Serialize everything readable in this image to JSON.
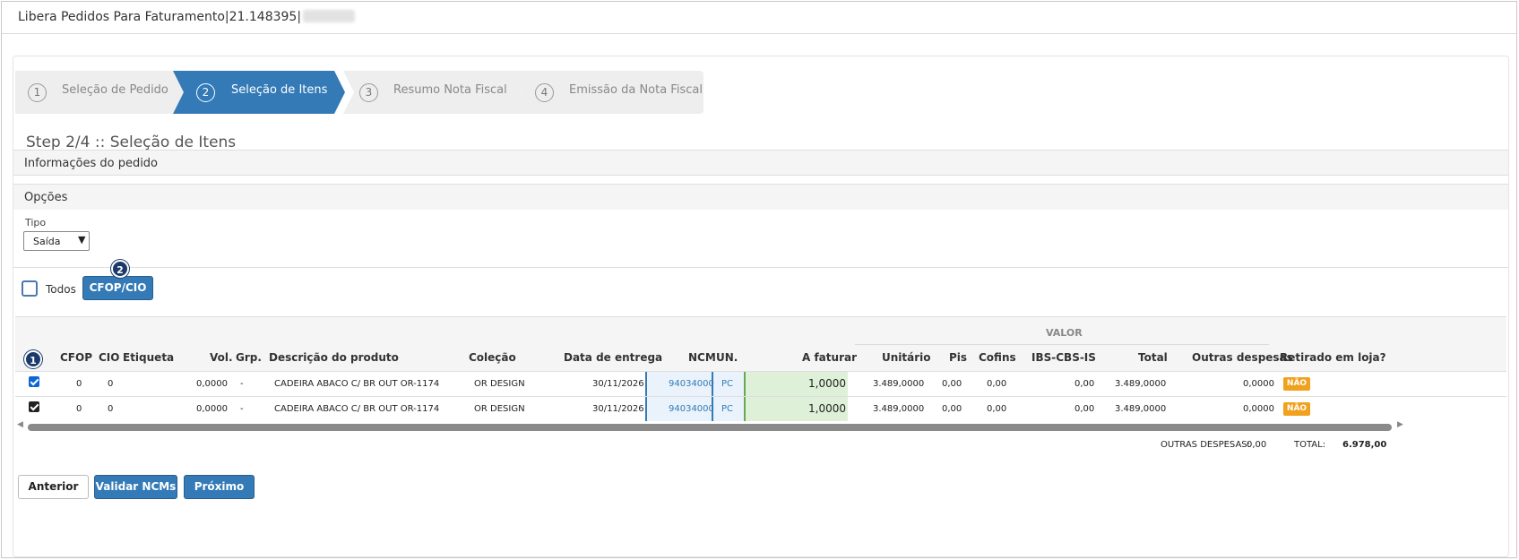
{
  "window": {
    "title": "Libera Pedidos Para Faturamento|21.148395|"
  },
  "wizard": [
    {
      "num": "1",
      "label": "Seleção de Pedido",
      "active": false
    },
    {
      "num": "2",
      "label": "Seleção de Itens",
      "active": true
    },
    {
      "num": "3",
      "label": "Resumo Nota Fiscal",
      "active": false
    },
    {
      "num": "4",
      "label": "Emissão da Nota Fiscal",
      "active": false
    }
  ],
  "step_title": "Step 2/4 :: Seleção de Itens",
  "sections": {
    "info": "Informações do pedido",
    "opcoes": "Opções"
  },
  "tipo": {
    "label": "Tipo",
    "value": "Saída"
  },
  "todos_label": "Todos",
  "cfop_button": "CFOP/CIO",
  "callouts": {
    "one": "1",
    "two": "2"
  },
  "table": {
    "group_header": "VALOR",
    "headers": {
      "cfop": "CFOP",
      "cio": "CIO",
      "etiqueta": "Etiqueta",
      "vol": "Vol.",
      "grp": "Grp.",
      "descricao": "Descrição do produto",
      "colecao": "Coleção",
      "data": "Data de entrega",
      "ncm": "NCM",
      "un": "UN.",
      "afaturar": "A faturar",
      "unitario": "Unitário",
      "pis": "Pis",
      "cofins": "Cofins",
      "ibs": "IBS-CBS-IS",
      "total": "Total",
      "outras": "Outras despesas",
      "retirado": "Retirado em loja?"
    },
    "rows": [
      {
        "cfop": "0",
        "cio": "0",
        "vol": "0,0000",
        "grp": "-",
        "descricao": "CADEIRA ABACO C/ BR OUT OR-1174",
        "colecao": "OR DESIGN",
        "data": "30/11/2026",
        "ncm": "94034000",
        "un": "PC",
        "afaturar": "1,0000",
        "unitario": "3.489,0000",
        "pis": "0,00",
        "cofins": "0,00",
        "ibs": "0,00",
        "total": "3.489,0000",
        "outras": "0,0000",
        "retirado": "NÃO"
      },
      {
        "cfop": "0",
        "cio": "0",
        "vol": "0,0000",
        "grp": "-",
        "descricao": "CADEIRA ABACO C/ BR OUT OR-1174",
        "colecao": "OR DESIGN",
        "data": "30/11/2026",
        "ncm": "94034000",
        "un": "PC",
        "afaturar": "1,0000",
        "unitario": "3.489,0000",
        "pis": "0,00",
        "cofins": "0,00",
        "ibs": "0,00",
        "total": "3.489,0000",
        "outras": "0,0000",
        "retirado": "NÃO"
      }
    ]
  },
  "totals": {
    "outras_label": "OUTRAS DESPESAS:",
    "outras_value": "0,00",
    "total_label": "TOTAL:",
    "total_value": "6.978,00"
  },
  "footer": {
    "anterior": "Anterior",
    "validar": "Validar NCMs",
    "proximo": "Próximo"
  },
  "colors": {
    "primary": "#337ab7",
    "badge": "#1b3a6b",
    "nao": "#f0a11e",
    "faturar_bg": "#dff0d8"
  }
}
